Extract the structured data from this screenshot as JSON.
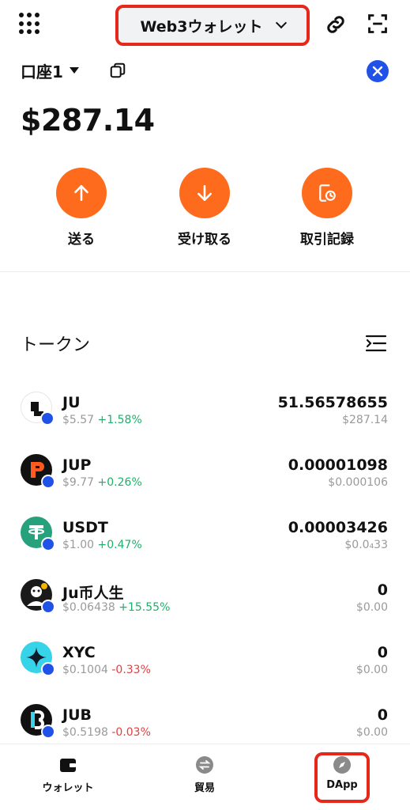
{
  "header": {
    "wallet_label": "Web3ウォレット"
  },
  "account": {
    "name": "口座1",
    "balance": "$287.14"
  },
  "actions": [
    {
      "label": "送る"
    },
    {
      "label": "受け取る"
    },
    {
      "label": "取引記録"
    }
  ],
  "tokens": {
    "title": "トークン",
    "items": [
      {
        "symbol": "JU",
        "price": "$5.57",
        "change": "+1.58%",
        "direction": "up",
        "amount": "51.56578655",
        "value": "$287.14"
      },
      {
        "symbol": "JUP",
        "price": "$9.77",
        "change": "+0.26%",
        "direction": "up",
        "amount": "0.00001098",
        "value": "$0.000106"
      },
      {
        "symbol": "USDT",
        "price": "$1.00",
        "change": "+0.47%",
        "direction": "up",
        "amount": "0.00003426",
        "value": "$0.0₄33"
      },
      {
        "symbol": "Ju币人生",
        "price": "$0.06438",
        "change": "+15.55%",
        "direction": "up",
        "amount": "0",
        "value": "$0.00"
      },
      {
        "symbol": "XYC",
        "price": "$0.1004",
        "change": "-0.33%",
        "direction": "down",
        "amount": "0",
        "value": "$0.00"
      },
      {
        "symbol": "JUB",
        "price": "$0.5198",
        "change": "-0.03%",
        "direction": "down",
        "amount": "0",
        "value": "$0.00"
      }
    ]
  },
  "nav": {
    "wallet": "ウォレット",
    "trade": "貿易",
    "dapp": "DApp"
  },
  "colors": {
    "accent": "#ff6b1c",
    "highlight": "#e8271b",
    "chain": "#2152e8",
    "positive": "#1bb26a",
    "negative": "#e34040"
  }
}
